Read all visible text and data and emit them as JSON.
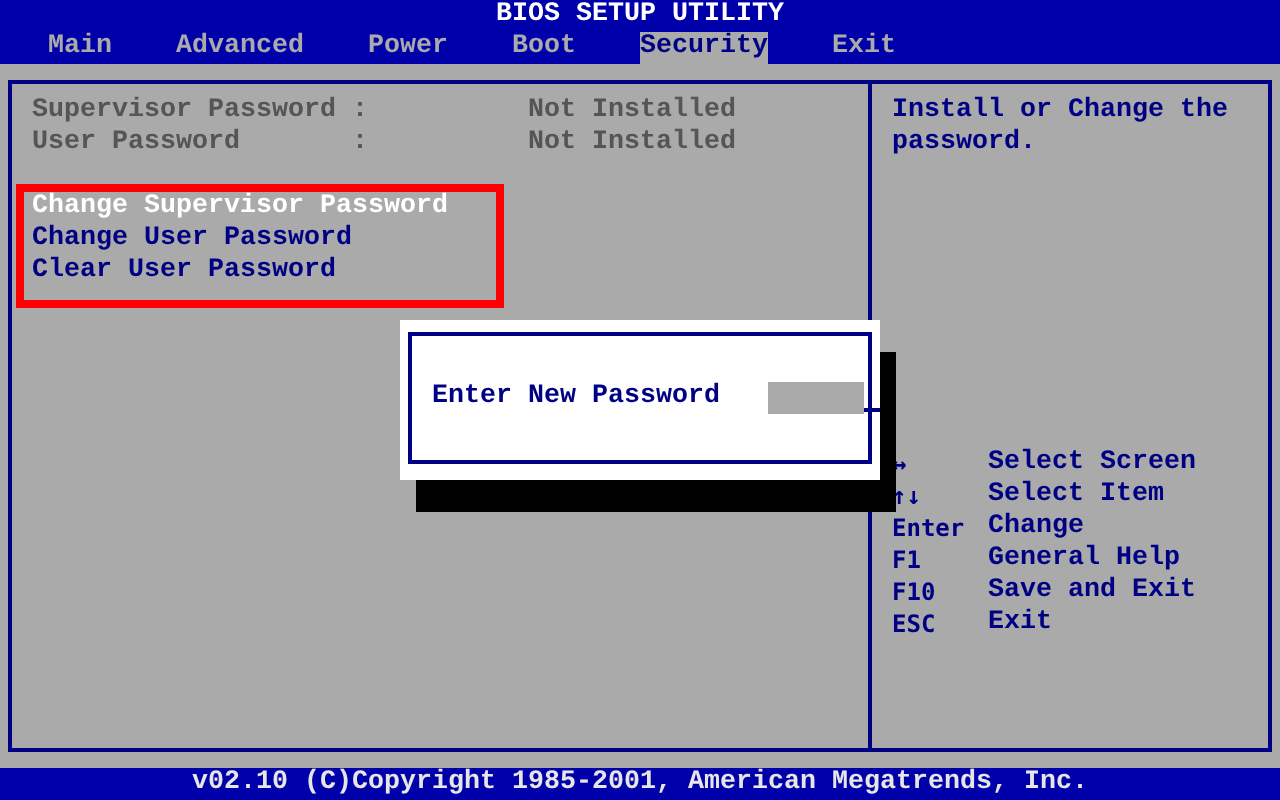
{
  "title": "BIOS SETUP UTILITY",
  "tabs": [
    {
      "label": "Main",
      "selected": false
    },
    {
      "label": "Advanced",
      "selected": false
    },
    {
      "label": "Power",
      "selected": false
    },
    {
      "label": "Boot",
      "selected": false
    },
    {
      "label": "Security",
      "selected": true
    },
    {
      "label": "Exit",
      "selected": false
    }
  ],
  "status_items": [
    {
      "label": "Supervisor Password",
      "separator": ":",
      "value": "Not Installed"
    },
    {
      "label": "User Password",
      "separator": ":",
      "value": "Not Installed"
    }
  ],
  "menu_items": [
    {
      "label": "Change Supervisor Password",
      "selected": true
    },
    {
      "label": "Change User Password",
      "selected": false
    },
    {
      "label": "Clear User Password",
      "selected": false
    }
  ],
  "dialog": {
    "prompt": "Enter New Password"
  },
  "help_text": "Install or Change the password.",
  "key_legend": [
    {
      "key": "↔",
      "action": "Select Screen"
    },
    {
      "key": "↑↓",
      "action": "Select Item"
    },
    {
      "key": "Enter",
      "action": "Change"
    },
    {
      "key": "F1",
      "action": "General Help"
    },
    {
      "key": "F10",
      "action": "Save and Exit"
    },
    {
      "key": "ESC",
      "action": "Exit"
    }
  ],
  "footer": "v02.10 (C)Copyright 1985-2001, American Megatrends, Inc."
}
